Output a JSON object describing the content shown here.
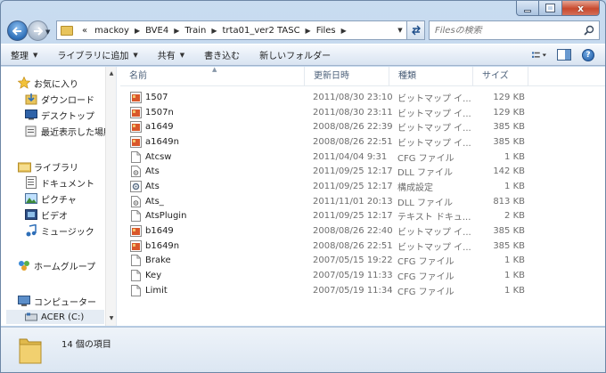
{
  "window": {
    "caption_buttons": {
      "minimize": "",
      "maximize": "",
      "close": "x"
    }
  },
  "address": {
    "overflow": "«",
    "crumbs": [
      "mackoy",
      "BVE4",
      "Train",
      "trta01_ver2 TASC",
      "Files"
    ]
  },
  "search": {
    "placeholder": "Filesの検索"
  },
  "toolbar": {
    "organize": "整理",
    "add_to_library": "ライブラリに追加",
    "share": "共有",
    "burn": "書き込む",
    "new_folder": "新しいフォルダー"
  },
  "nav": {
    "favorites": "お気に入り",
    "downloads": "ダウンロード",
    "desktop": "デスクトップ",
    "recent": "最近表示した場所",
    "libraries": "ライブラリ",
    "documents": "ドキュメント",
    "pictures": "ピクチャ",
    "videos": "ビデオ",
    "music": "ミュージック",
    "homegroup": "ホームグループ",
    "computer": "コンピューター",
    "drive_c": "ACER (C:)"
  },
  "columns": {
    "name": "名前",
    "date": "更新日時",
    "type": "種類",
    "size": "サイズ"
  },
  "files": [
    {
      "name": "1507",
      "date": "2011/08/30 23:10",
      "type": "ビットマップ イ...",
      "size": "129 KB",
      "icon": "bitmap-icon"
    },
    {
      "name": "1507n",
      "date": "2011/08/30 23:11",
      "type": "ビットマップ イ...",
      "size": "129 KB",
      "icon": "bitmap-icon"
    },
    {
      "name": "a1649",
      "date": "2008/08/26 22:39",
      "type": "ビットマップ イ...",
      "size": "385 KB",
      "icon": "bitmap-icon"
    },
    {
      "name": "a1649n",
      "date": "2008/08/26 22:51",
      "type": "ビットマップ イ...",
      "size": "385 KB",
      "icon": "bitmap-icon"
    },
    {
      "name": "Atcsw",
      "date": "2011/04/04 9:31",
      "type": "CFG ファイル",
      "size": "1 KB",
      "icon": "file-icon"
    },
    {
      "name": "Ats",
      "date": "2011/09/25 12:17",
      "type": "DLL ファイル",
      "size": "142 KB",
      "icon": "dll-icon"
    },
    {
      "name": "Ats",
      "date": "2011/09/25 12:17",
      "type": "構成設定",
      "size": "1 KB",
      "icon": "settings-icon"
    },
    {
      "name": "Ats_",
      "date": "2011/11/01 20:13",
      "type": "DLL ファイル",
      "size": "813 KB",
      "icon": "dll-icon"
    },
    {
      "name": "AtsPlugin",
      "date": "2011/09/25 12:17",
      "type": "テキスト ドキュ...",
      "size": "2 KB",
      "icon": "file-icon"
    },
    {
      "name": "b1649",
      "date": "2008/08/26 22:40",
      "type": "ビットマップ イ...",
      "size": "385 KB",
      "icon": "bitmap-icon"
    },
    {
      "name": "b1649n",
      "date": "2008/08/26 22:51",
      "type": "ビットマップ イ...",
      "size": "385 KB",
      "icon": "bitmap-icon"
    },
    {
      "name": "Brake",
      "date": "2007/05/15 19:22",
      "type": "CFG ファイル",
      "size": "1 KB",
      "icon": "file-icon"
    },
    {
      "name": "Key",
      "date": "2007/05/19 11:33",
      "type": "CFG ファイル",
      "size": "1 KB",
      "icon": "file-icon"
    },
    {
      "name": "Limit",
      "date": "2007/05/19 11:34",
      "type": "CFG ファイル",
      "size": "1 KB",
      "icon": "file-icon"
    }
  ],
  "status": {
    "item_count": "14 個の項目"
  },
  "colors": {
    "accent": "#2e6fb8",
    "bitmap": "#d9572b",
    "folder": "#e8c45c"
  }
}
